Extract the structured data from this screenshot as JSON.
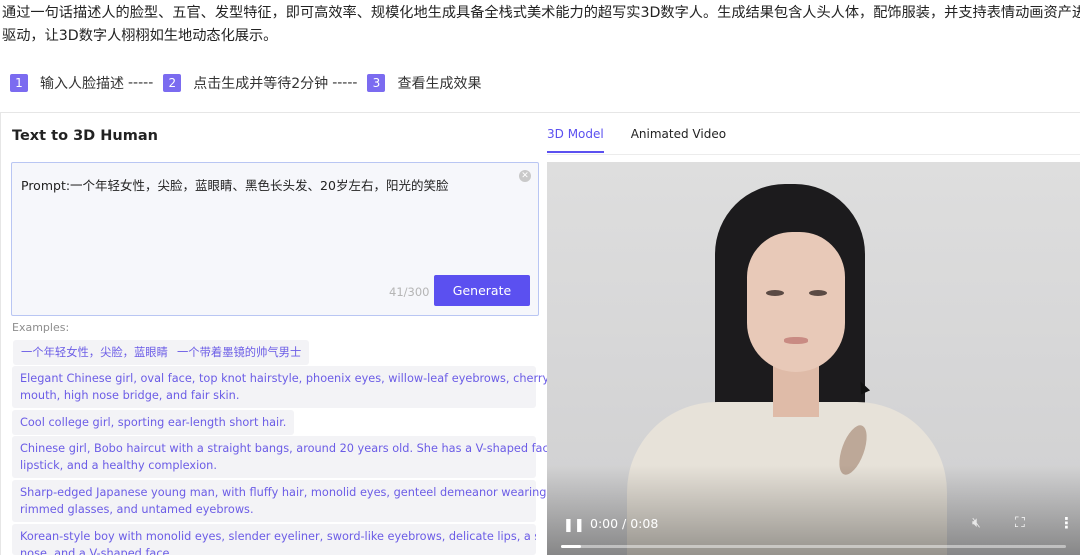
{
  "intro": {
    "line1": "通过一句话描述人的脸型、五官、发型特征，即可高效率、规模化地生成具备全栈式美术能力的超写实3D数字人。生成结果包含人头人体，配饰服装，并支持表情动画资产进行",
    "line2": "驱动，让3D数字人栩栩如生地动态化展示。"
  },
  "steps": [
    {
      "num": "1",
      "label": "输入人脸描述",
      "sep": "-----"
    },
    {
      "num": "2",
      "label": "点击生成并等待2分钟",
      "sep": "-----"
    },
    {
      "num": "3",
      "label": "查看生成效果",
      "sep": ""
    }
  ],
  "left": {
    "title": "Text to 3D Human",
    "prompt": "Prompt:一个年轻女性，尖脸，蓝眼睛、黑色长头发、20岁左右，阳光的笑脸",
    "counter": "41/300",
    "generate_label": "Generate",
    "examples_label": "Examples:",
    "examples": [
      "一个年轻女性，尖脸，蓝眼睛",
      "一个带着墨镜的帅气男士",
      "Elegant Chinese girl, oval face, top knot hairstyle, phoenix eyes, willow-leaf eyebrows, cherry-like",
      "mouth, high nose bridge, and fair skin.",
      "Cool college girl, sporting ear-length short hair.",
      "Chinese girl, Bobo haircut with a straight bangs, around 20 years old. She has a V-shaped face, cameo",
      "lipstick, and a healthy complexion.",
      "Sharp-edged Japanese young man, with fluffy hair, monolid eyes, genteel demeanor wearing gold-",
      "rimmed glasses, and untamed eyebrows.",
      "Korean-style boy with monolid eyes, slender eyeliner, sword-like eyebrows, delicate lips, a slender",
      "nose, and a V-shaped face."
    ]
  },
  "right": {
    "tabs": [
      "3D Model",
      "Animated Video"
    ],
    "active_tab": "3D Model",
    "video": {
      "time": "0:00 / 0:08",
      "progress": 0.04
    }
  },
  "colors": {
    "accent": "#5b50f0",
    "chip_text": "#6b5ce6",
    "step_badge": "#7b6bf0"
  }
}
